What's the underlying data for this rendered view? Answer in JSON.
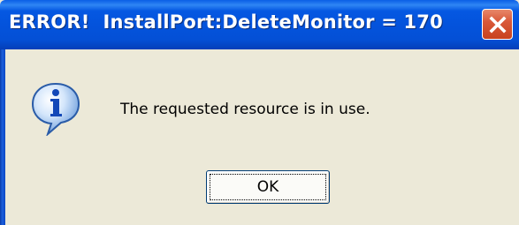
{
  "window": {
    "title": "ERROR!  InstallPort:DeleteMonitor = 170"
  },
  "dialog": {
    "icon": "info-icon",
    "message": "The requested resource is in use.",
    "ok_label": "OK"
  },
  "colors": {
    "titlebar": "#0454dc",
    "close_button": "#d9593a",
    "dialog_background": "#ece9d8",
    "button_border": "#003c74"
  }
}
